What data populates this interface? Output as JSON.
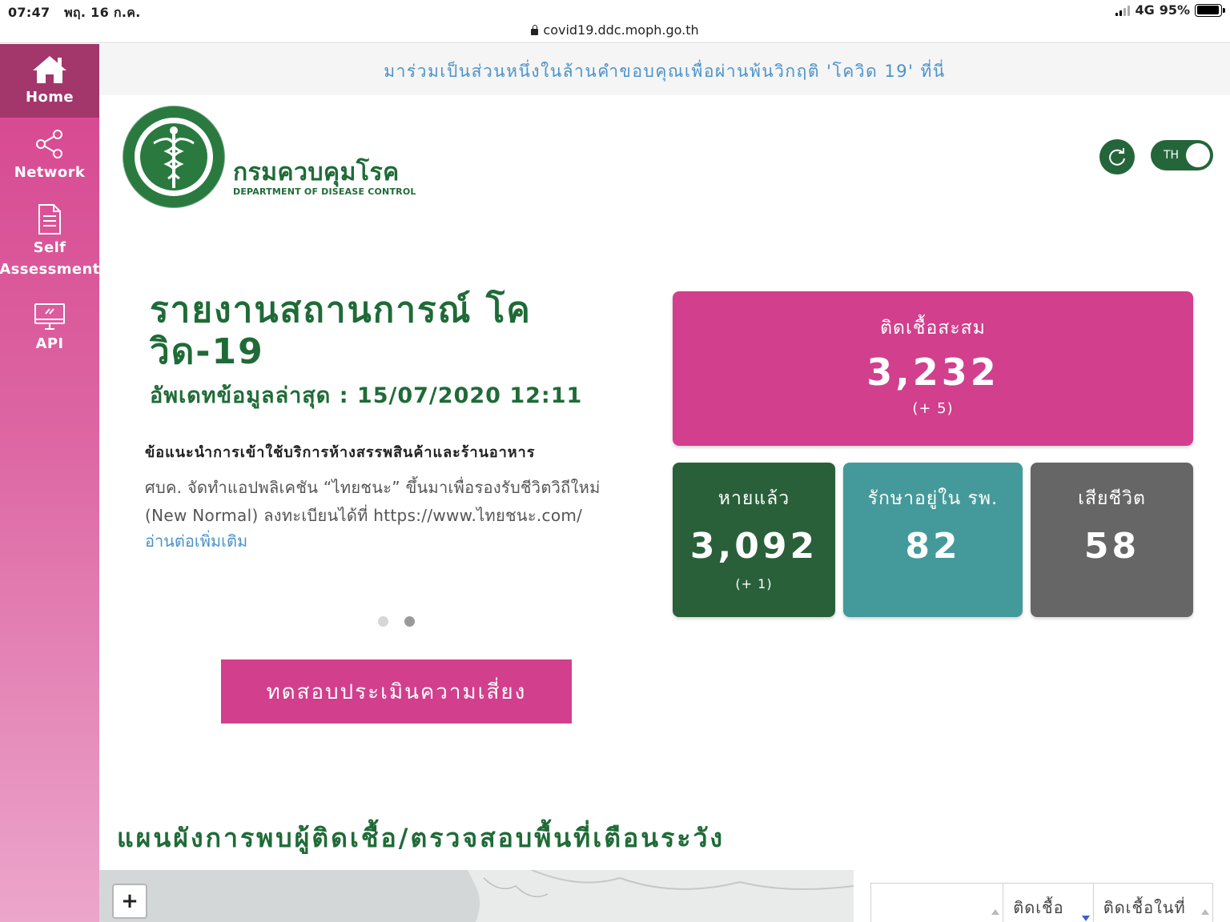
{
  "status_bar": {
    "time": "07:47",
    "date": "พฤ. 16 ก.ค.",
    "network": "4G",
    "battery": "95%",
    "battery_level": 0.95
  },
  "url_bar": {
    "url": "covid19.ddc.moph.go.th"
  },
  "sidebar": {
    "items": [
      {
        "label": "Home",
        "icon": "home-icon",
        "active": true
      },
      {
        "label": "Network",
        "icon": "share-network-icon"
      },
      {
        "label": "Self\nAssessment",
        "icon": "document-icon"
      },
      {
        "label": "API",
        "icon": "monitor-icon"
      }
    ]
  },
  "banner": {
    "text": "มาร่วมเป็นส่วนหนึ่งในล้านคำขอบคุณเพื่อผ่านพ้นวิกฤติ 'โควิด 19' ที่นี่"
  },
  "header": {
    "org_title": "กรมควบคุมโรค",
    "org_subtitle": "DEPARTMENT OF DISEASE CONTROL",
    "refresh_icon": "refresh-icon",
    "lang_toggle": "TH"
  },
  "main": {
    "headline": "รายงานสถานการณ์ โควิด-19",
    "updated": "อัพเดทข้อมูลล่าสุด : 15/07/2020 12:11",
    "news": {
      "title": "ข้อแนะนำการเข้าใช้บริการห้างสรรพสินค้าและร้านอาหาร",
      "body": "ศบค. จัดทำแอปพลิเคชัน “ไทยชนะ” ขึ้นมาเพื่อรองรับชีวิตวิถีใหม่ (New Normal) ลงทะเบียนได้ที่ https://www.ไทยชนะ.com/",
      "more": "อ่านต่อเพิ่มเติม"
    },
    "carousel": {
      "count": 2,
      "active": 2
    },
    "assess_button": "ทดสอบประเมินความเสี่ยง"
  },
  "stats": {
    "total": {
      "label": "ติดเชื้อสะสม",
      "value": "3,232",
      "delta": "(+ 5)"
    },
    "recovered": {
      "label": "หายแล้ว",
      "value": "3,092",
      "delta": "(+ 1)"
    },
    "hospitalized": {
      "label": "รักษาอยู่ใน รพ.",
      "value": "82"
    },
    "deaths": {
      "label": "เสียชีวิต",
      "value": "58"
    }
  },
  "map_section": {
    "title": "แผนผังการพบผู้ติดเชื้อ/ตรวจสอบพื้นที่เตือนระวัง",
    "zoom_in": "+"
  },
  "table": {
    "headers": [
      "",
      "ติดเชื้อ",
      "ติดเชื้อในที่"
    ]
  },
  "colors": {
    "brand_green": "#1f6b37",
    "brand_pink": "#d13f8d",
    "teal": "#449a9a",
    "gray": "#666666",
    "link_blue": "#4b93c9"
  }
}
